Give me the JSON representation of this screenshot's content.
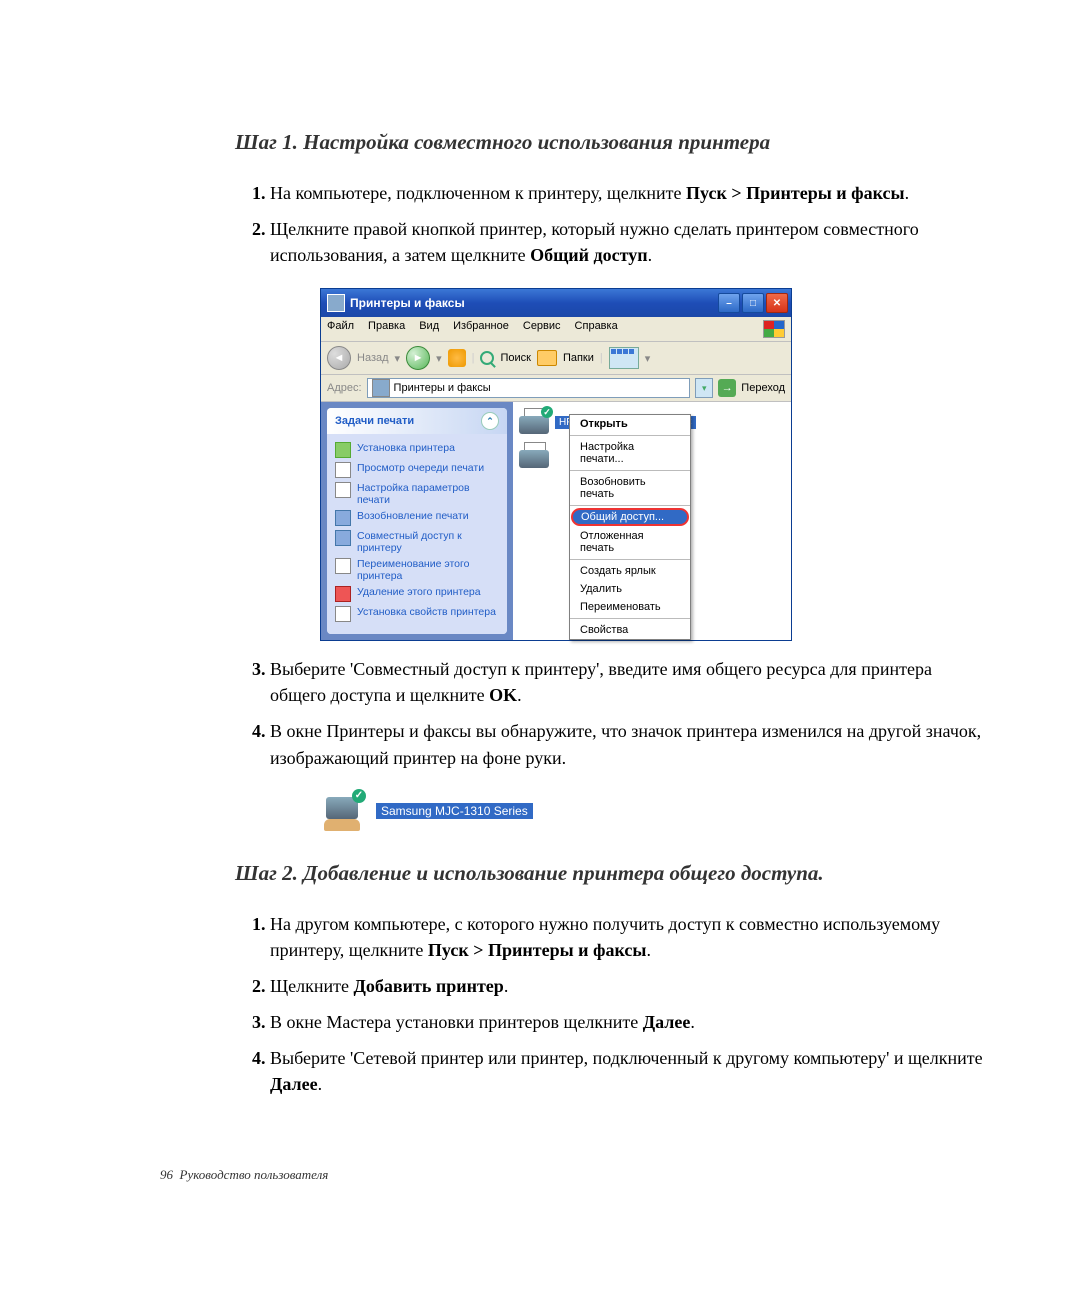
{
  "step1": {
    "heading": "Шаг 1. Настройка совместного использования принтера",
    "items": [
      {
        "before": "На компьютере, подключенном к принтеру, щелкните ",
        "b": "Пуск > Принтеры и факсы",
        "after": "."
      },
      {
        "before": "Щелкните правой кнопкой принтер, который нужно сделать принтером совместного использования, а затем щелкните ",
        "b": "Общий доступ",
        "after": "."
      },
      {
        "before": "Выберите 'Совместный доступ к принтеру', введите имя общего ресурса для принтера общего доступа и щелкните ",
        "b": "OK",
        "after": "."
      },
      {
        "before": "В окне Принтеры и факсы вы обнаружите, что значок принтера изменился на другой значок, изображающий принтер на фоне руки.",
        "b": "",
        "after": ""
      }
    ]
  },
  "step2": {
    "heading": "Шаг 2. Добавление и использование принтера общего доступа.",
    "items": [
      {
        "before": "На другом компьютере, с которого нужно получить доступ к совместно используемому принтеру, щелкните ",
        "b": "Пуск > Принтеры и факсы",
        "after": "."
      },
      {
        "before": "Щелкните ",
        "b": "Добавить принтер",
        "after": "."
      },
      {
        "before": "В окне Мастера установки принтеров щелкните ",
        "b": "Далее",
        "after": "."
      },
      {
        "before": "Выберите 'Сетевой принтер или принтер, подключенный к другому компьютеру' и щелкните ",
        "b": "Далее",
        "after": "."
      }
    ]
  },
  "xp": {
    "title": "Принтеры и факсы",
    "menus": [
      "Файл",
      "Правка",
      "Вид",
      "Избранное",
      "Сервис",
      "Справка"
    ],
    "nav": {
      "back": "Назад",
      "search": "Поиск",
      "folders": "Папки"
    },
    "addr": {
      "label": "Адрес:",
      "value": "Принтеры и факсы",
      "go": "Переход"
    },
    "task": {
      "head": "Задачи печати",
      "items": [
        "Установка принтера",
        "Просмотр очереди печати",
        "Настройка параметров печати",
        "Возобновление печати",
        "Совместный доступ к принтеру",
        "Переименование этого принтера",
        "Удаление этого принтера",
        "Установка свойств принтера"
      ]
    },
    "printer_label": "HP DeskJet 950C/952C/959C",
    "ctx": [
      "Открыть",
      "Настройка печати...",
      "Возобновить печать",
      "Общий доступ...",
      "Отложенная печать",
      "Создать ярлык",
      "Удалить",
      "Переименовать",
      "Свойства"
    ]
  },
  "shared_label": "Samsung MJC-1310 Series",
  "footer": {
    "pg": "96",
    "txt": "Руководство пользователя"
  }
}
